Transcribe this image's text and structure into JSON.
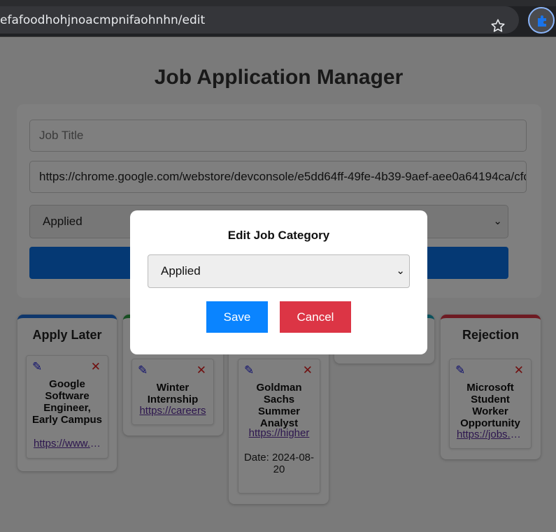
{
  "browser": {
    "url": "efafoodhohjnoacmpnifaohnhn/edit",
    "star_icon": "star-icon",
    "extension_icon": "puzzle-icon"
  },
  "page": {
    "title": "Job Application Manager",
    "form": {
      "job_title_placeholder": "Job Title",
      "url_value": "https://chrome.google.com/webstore/devconsole/e5dd64ff-49fe-4b39-9aef-aee0a64194ca/cfc",
      "category_value": "Applied"
    }
  },
  "columns": [
    {
      "title": "Apply Later",
      "color": "#1e6fd9",
      "cards": [
        {
          "title": "Google Software Engineer, Early Campus",
          "link": "https://www.google.com",
          "date": ""
        }
      ]
    },
    {
      "title": "",
      "color": "#2e9e45",
      "cards": [
        {
          "title": "Winter Internship",
          "link": "https://careers",
          "date": ""
        }
      ]
    },
    {
      "title": "",
      "color": "#e0a800",
      "cards": [
        {
          "title": "Goldman Sachs Summer Analyst",
          "link": "https://higher",
          "date": "Date: 2024-08-20"
        }
      ]
    },
    {
      "title": "",
      "color": "#17a2b8",
      "cards": []
    },
    {
      "title": "Rejection",
      "color": "#dc3545",
      "cards": [
        {
          "title": "Microsoft Student Worker Opportunity",
          "link": "https://jobs.microsoft",
          "date": ""
        }
      ]
    }
  ],
  "card_icons": {
    "edit": "✎",
    "delete": "✕"
  },
  "modal": {
    "title": "Edit Job Category",
    "selected": "Applied",
    "save_label": "Save",
    "cancel_label": "Cancel"
  }
}
